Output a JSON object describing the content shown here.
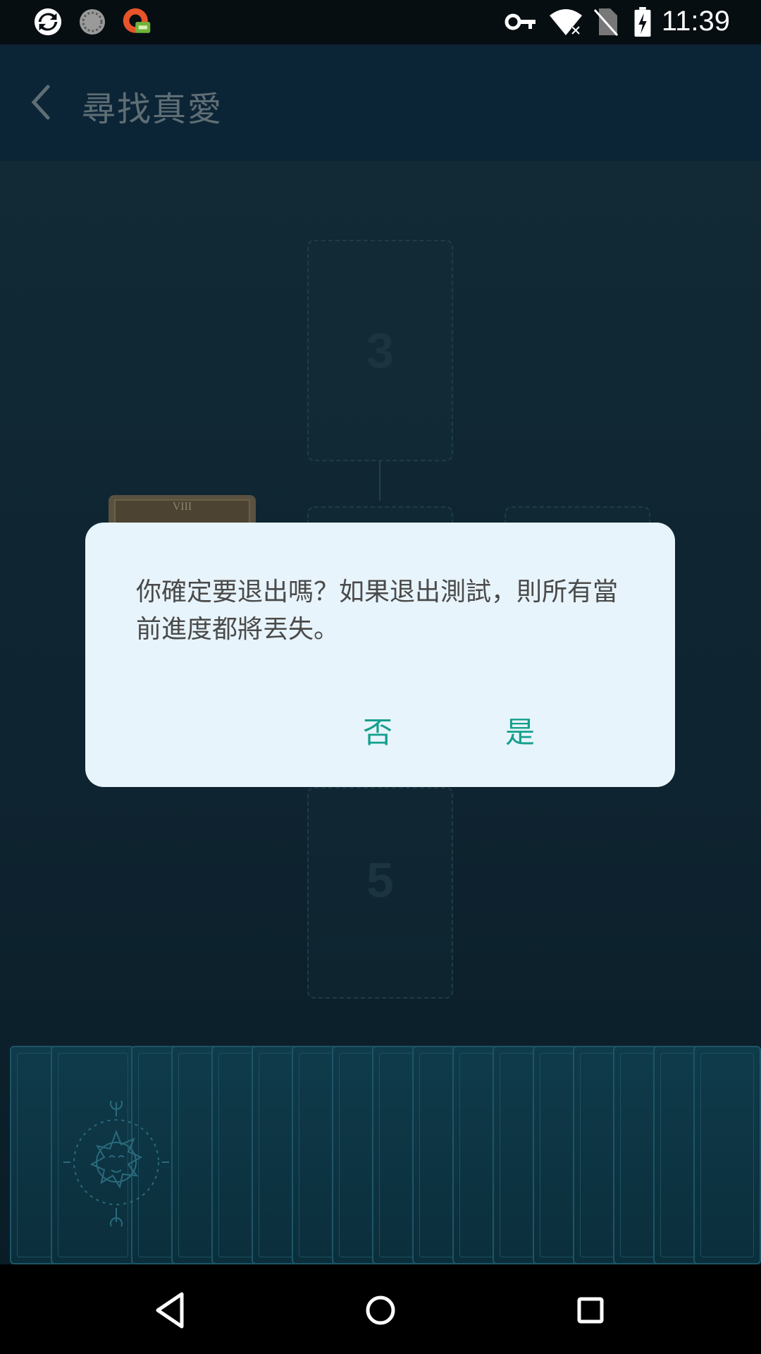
{
  "status_bar": {
    "time": "11:39",
    "left_icons": [
      "sync-app-icon",
      "loading-circle-icon",
      "vpn-app-icon"
    ],
    "right_icons": [
      "vpn-key-icon",
      "wifi-no-internet-icon",
      "no-sim-icon",
      "battery-charging-icon"
    ]
  },
  "app_bar": {
    "title": "尋找真愛",
    "back_icon": "chevron-left-icon"
  },
  "spread": {
    "slots": [
      {
        "number": "3"
      },
      {
        "number": "5"
      }
    ],
    "placed_card_label": "VIII"
  },
  "dialog": {
    "message": "你確定要退出嗎？如果退出測試，則所有當前進度都將丟失。",
    "no_label": "否",
    "yes_label": "是"
  },
  "colors": {
    "accent": "#14a08d",
    "dialog_bg": "#e8f4fb",
    "background": "#0e2531"
  },
  "nav_bar": {
    "icons": [
      "back-triangle-icon",
      "home-circle-icon",
      "recents-square-icon"
    ]
  }
}
